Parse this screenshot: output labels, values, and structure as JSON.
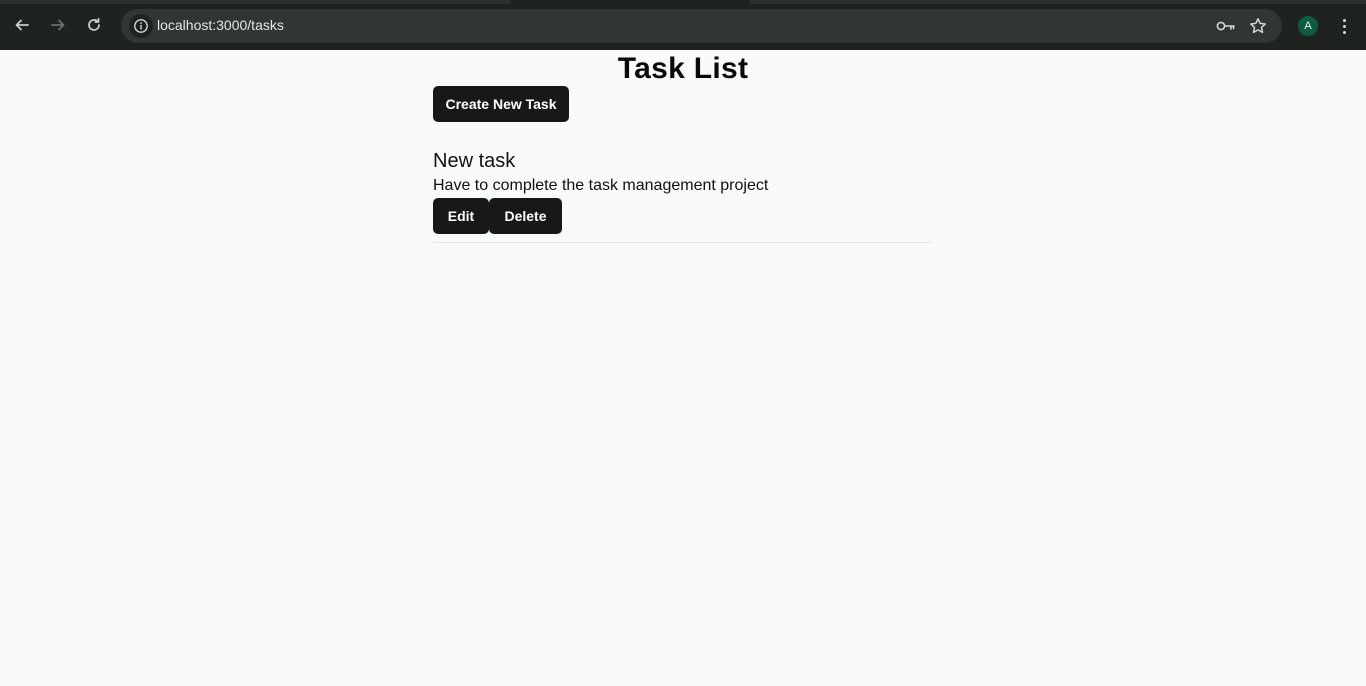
{
  "browser": {
    "url": "localhost:3000/tasks",
    "back_icon": "back-arrow-icon",
    "forward_icon": "forward-arrow-icon",
    "reload_icon": "reload-icon",
    "site_info_icon": "info-icon",
    "password_icon": "key-icon",
    "bookmark_icon": "star-icon",
    "profile_initial": "A",
    "menu_icon": "vertical-dots-icon"
  },
  "page": {
    "title": "Task List",
    "create_button_label": "Create New Task",
    "tasks": [
      {
        "title": "New task",
        "description": "Have to complete the task management project",
        "edit_label": "Edit",
        "delete_label": "Delete"
      }
    ]
  },
  "colors": {
    "page_background": "#f8fafc",
    "button_background": "#18181b",
    "button_text": "#ffffff",
    "browser_chrome": "#1f2320"
  }
}
